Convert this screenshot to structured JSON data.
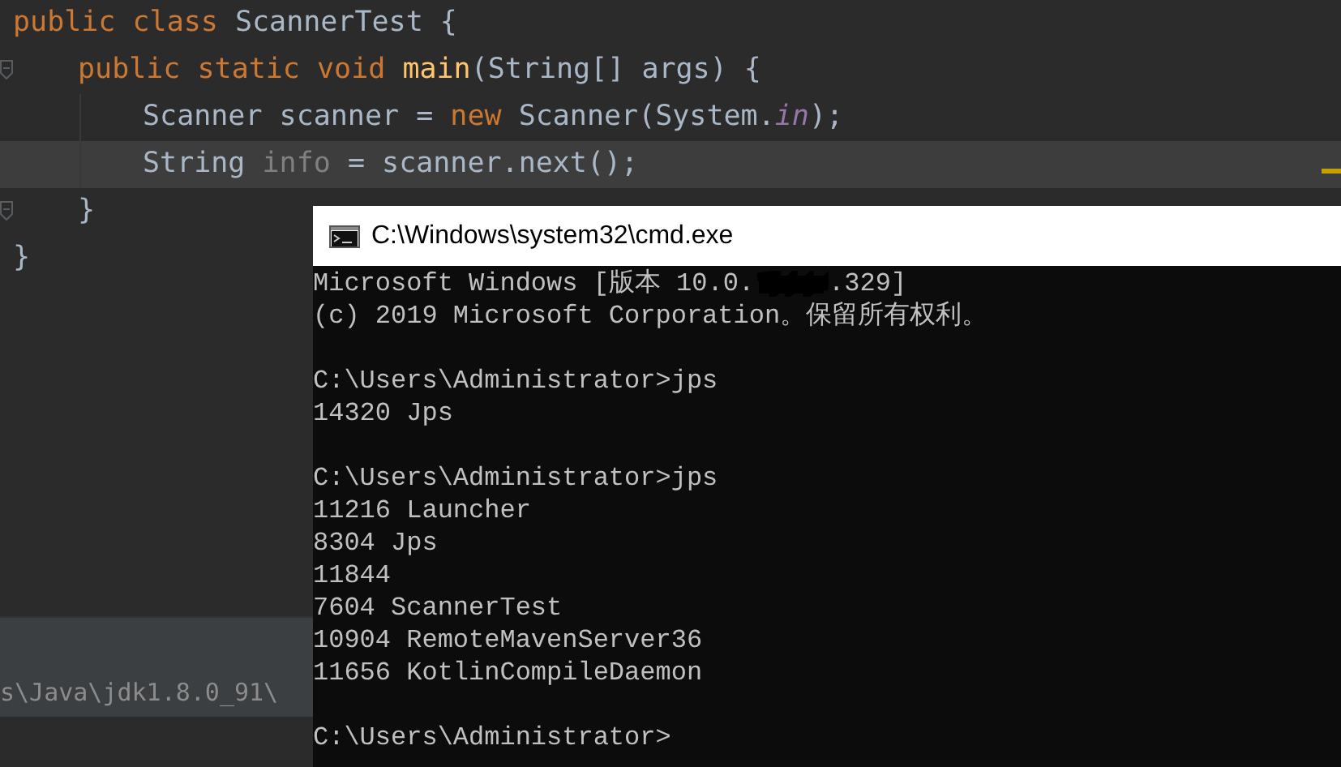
{
  "editor": {
    "lines": [
      {
        "fold": false,
        "current": false,
        "tokens": [
          {
            "kind": "keyword",
            "text": "public class "
          },
          {
            "kind": "plain",
            "text": "ScannerTest {"
          }
        ],
        "children": [
          {
            "fold": true,
            "current": false,
            "tokens": [
              {
                "kind": "keyword",
                "text": "public static void "
              },
              {
                "kind": "method",
                "text": "main"
              },
              {
                "kind": "plain",
                "text": "(String[] args) {"
              }
            ],
            "children": [
              {
                "fold": false,
                "current": false,
                "tokens": [
                  {
                    "kind": "plain",
                    "text": "Scanner scanner = "
                  },
                  {
                    "kind": "keyword",
                    "text": "new "
                  },
                  {
                    "kind": "plain",
                    "text": "Scanner(System."
                  },
                  {
                    "kind": "field",
                    "text": "in"
                  },
                  {
                    "kind": "plain",
                    "text": ");"
                  }
                ]
              },
              {
                "fold": false,
                "current": true,
                "tokens": [
                  {
                    "kind": "plain",
                    "text": "String "
                  },
                  {
                    "kind": "unused",
                    "text": "info"
                  },
                  {
                    "kind": "plain",
                    "text": " = scanner.next();"
                  }
                ]
              }
            ]
          },
          {
            "fold": true,
            "current": false,
            "tokens": [
              {
                "kind": "plain",
                "text": "}"
              }
            ]
          }
        ]
      },
      {
        "fold": false,
        "current": false,
        "tokens": [
          {
            "kind": "plain",
            "text": "}"
          }
        ]
      }
    ]
  },
  "bottom_panel": {
    "path": "s\\Java\\jdk1.8.0_91\\"
  },
  "console": {
    "title": "C:\\Windows\\system32\\cmd.exe",
    "lines": [
      {
        "kind": "redacted",
        "before": "Microsoft Windows [版本 10.0.",
        "after": ".329]"
      },
      {
        "kind": "text",
        "text": "(c) 2019 Microsoft Corporation。保留所有权利。"
      },
      {
        "kind": "blank"
      },
      {
        "kind": "text",
        "text": "C:\\Users\\Administrator>jps"
      },
      {
        "kind": "text",
        "text": "14320 Jps"
      },
      {
        "kind": "blank"
      },
      {
        "kind": "text",
        "text": "C:\\Users\\Administrator>jps"
      },
      {
        "kind": "text",
        "text": "11216 Launcher"
      },
      {
        "kind": "text",
        "text": "8304 Jps"
      },
      {
        "kind": "text",
        "text": "11844"
      },
      {
        "kind": "text",
        "text": "7604 ScannerTest"
      },
      {
        "kind": "text",
        "text": "10904 RemoteMavenServer36"
      },
      {
        "kind": "text",
        "text": "11656 KotlinCompileDaemon"
      },
      {
        "kind": "blank"
      },
      {
        "kind": "text",
        "text": "C:\\Users\\Administrator>"
      }
    ]
  }
}
